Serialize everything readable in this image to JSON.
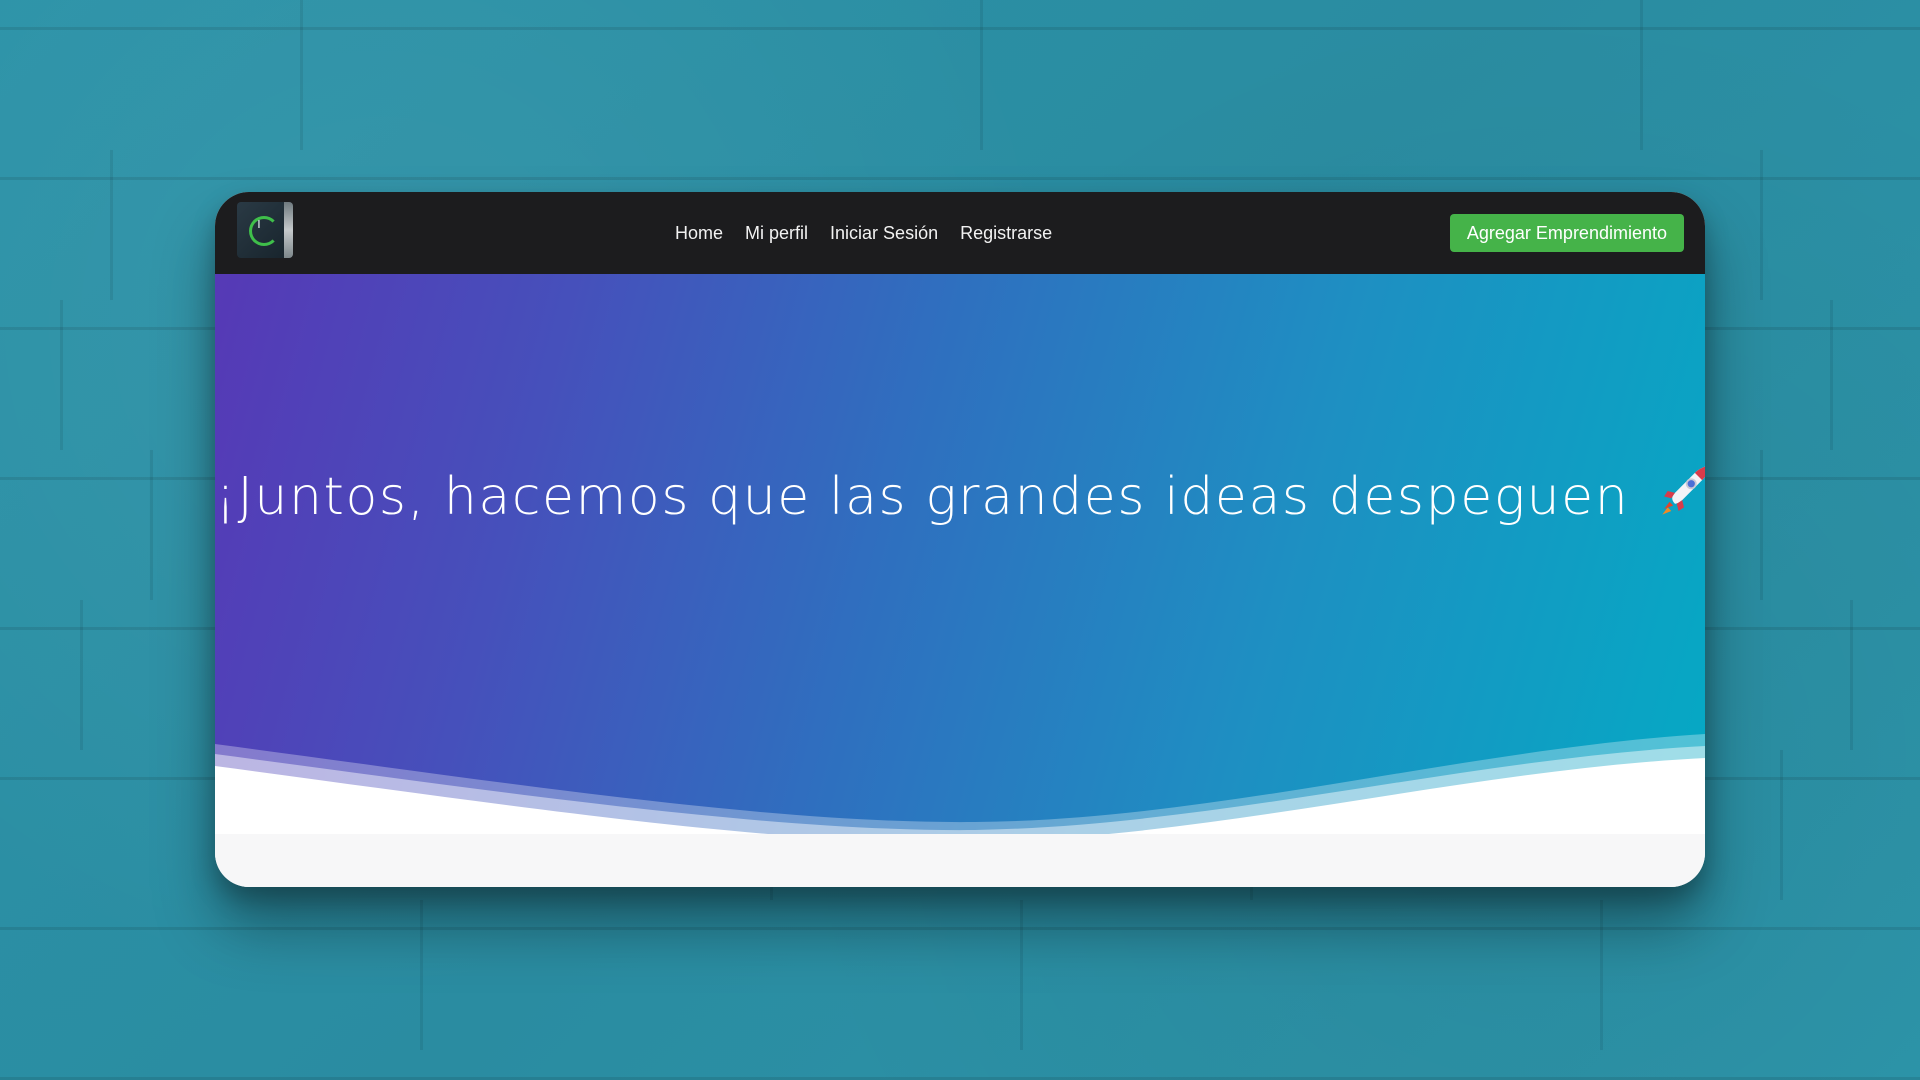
{
  "navbar": {
    "logo_icon": "brand-logo-icon",
    "links": [
      {
        "label": "Home"
      },
      {
        "label": "Mi perfil"
      },
      {
        "label": "Iniciar Sesión"
      },
      {
        "label": "Registrarse"
      }
    ],
    "cta_label": "Agregar Emprendimiento"
  },
  "hero": {
    "title_before": "¡Juntos, hacemos que las grandes ideas despeguen",
    "title_icon": "rocket-icon",
    "title_after": "!"
  },
  "colors": {
    "navbar_bg": "#1c1c1e",
    "cta_bg": "#45b349",
    "hero_gradient_start": "#5639b6",
    "hero_gradient_end": "#05a9c4",
    "wall": "#2a8fa4"
  }
}
